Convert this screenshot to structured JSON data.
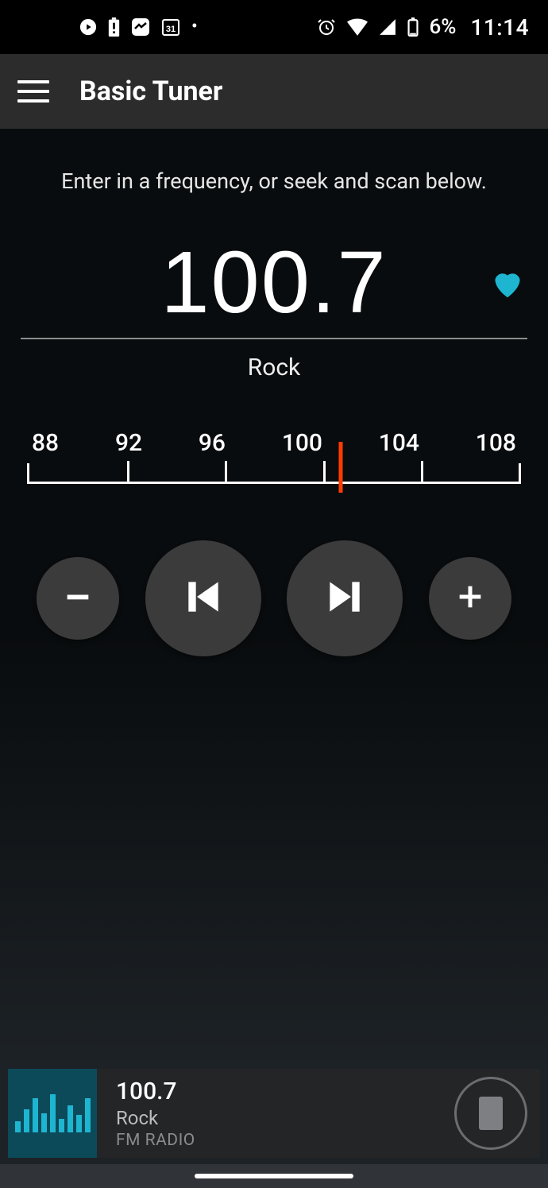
{
  "status": {
    "battery_percent": "6%",
    "time": "11:14"
  },
  "app": {
    "title": "Basic Tuner"
  },
  "main": {
    "instruction": "Enter in a frequency, or seek and scan below.",
    "frequency": "100.7",
    "genre": "Rock"
  },
  "dial": {
    "min": 88,
    "max": 108,
    "labels": [
      "88",
      "92",
      "96",
      "100",
      "104",
      "108"
    ],
    "needle_value": 100.7
  },
  "controls": {
    "minus_label": "decrease frequency",
    "seek_prev_label": "seek previous",
    "seek_next_label": "seek next",
    "plus_label": "increase frequency"
  },
  "now_playing": {
    "frequency": "100.7",
    "genre": "Rock",
    "band": "FM RADIO"
  }
}
